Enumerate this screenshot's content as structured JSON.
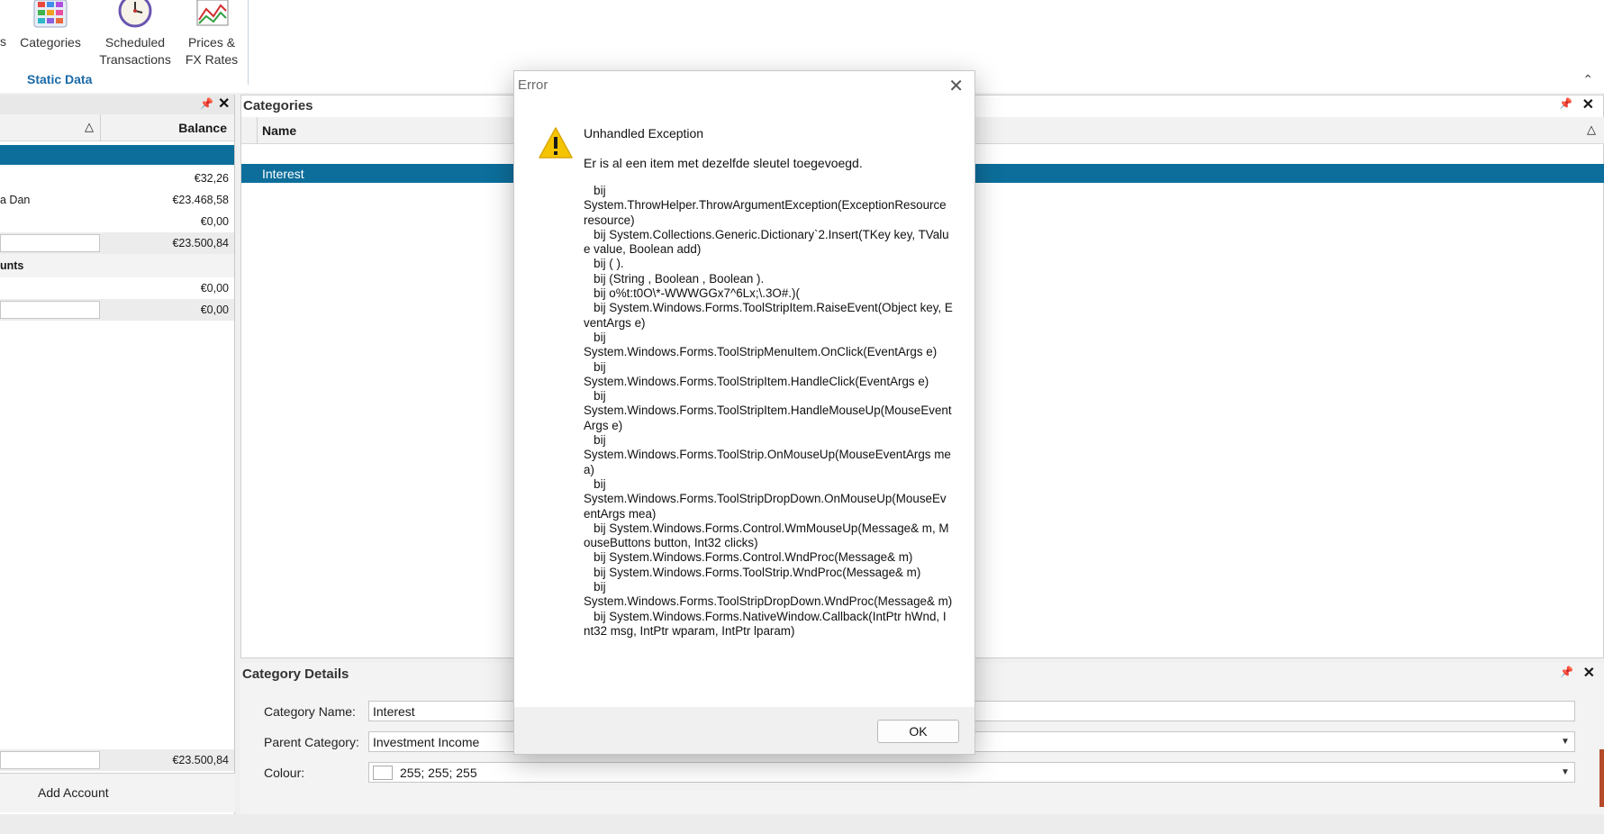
{
  "ribbon": {
    "partial_label": "s",
    "categories_label": "Categories",
    "scheduled_line1": "Scheduled",
    "scheduled_line2": "Transactions",
    "prices_line1": "Prices &",
    "prices_line2": "FX Rates",
    "group_label": "Static Data",
    "collapse_glyph": "⌃"
  },
  "accounts": {
    "header_balance": "Balance",
    "sort_glyph": "△",
    "rows": [
      {
        "name": "",
        "value": "€32,26"
      },
      {
        "name": "a Dan",
        "value": "€23.468,58"
      },
      {
        "name": "",
        "value": "€0,00"
      }
    ],
    "subtotal_1": "€23.500,84",
    "group_2_label": "unts",
    "group_2_row_value": "€0,00",
    "subtotal_2": "€0,00",
    "grand_total": "€23.500,84",
    "add_button": "Add Account"
  },
  "categories": {
    "title": "Categories",
    "column_name": "Name",
    "selected_row": "Interest"
  },
  "details": {
    "title": "Category Details",
    "name_label": "Category Name:",
    "name_value": "Interest",
    "parent_label": "Parent Category:",
    "parent_value": "Investment Income",
    "colour_label": "Colour:",
    "colour_value": "255; 255; 255"
  },
  "dialog": {
    "title": "Error",
    "heading": "Unhandled Exception",
    "message": "Er is al een item met dezelfde sleutel toegevoegd.",
    "stack_trace": "   bij\nSystem.ThrowHelper.ThrowArgumentException(ExceptionResource resource)\n   bij System.Collections.Generic.Dictionary`2.Insert(TKey key, TValue value, Boolean add)\n   bij ( ).\n   bij (String , Boolean , Boolean ).\n   bij o%t:t0O\\*-WWWGGx7^6Lx;\\.3O#.)(\n   bij System.Windows.Forms.ToolStripItem.RaiseEvent(Object key, EventArgs e)\n   bij\nSystem.Windows.Forms.ToolStripMenuItem.OnClick(EventArgs e)\n   bij\nSystem.Windows.Forms.ToolStripItem.HandleClick(EventArgs e)\n   bij\nSystem.Windows.Forms.ToolStripItem.HandleMouseUp(MouseEventArgs e)\n   bij\nSystem.Windows.Forms.ToolStrip.OnMouseUp(MouseEventArgs mea)\n   bij\nSystem.Windows.Forms.ToolStripDropDown.OnMouseUp(MouseEventArgs mea)\n   bij System.Windows.Forms.Control.WmMouseUp(Message& m, MouseButtons button, Int32 clicks)\n   bij System.Windows.Forms.Control.WndProc(Message& m)\n   bij System.Windows.Forms.ToolStrip.WndProc(Message& m)\n   bij\nSystem.Windows.Forms.ToolStripDropDown.WndProc(Message& m)\n   bij System.Windows.Forms.NativeWindow.Callback(IntPtr hWnd, Int32 msg, IntPtr wparam, IntPtr lparam)",
    "ok_label": "OK"
  },
  "colors": {
    "selection": "#0d6e9b",
    "group_label": "#1a6aa8",
    "warning": "#f5c400"
  },
  "icons": [
    "categories-icon",
    "scheduled-clock-icon",
    "prices-chart-icon",
    "pin-icon",
    "close-icon",
    "warning-icon",
    "dropdown-arrow-icon"
  ]
}
